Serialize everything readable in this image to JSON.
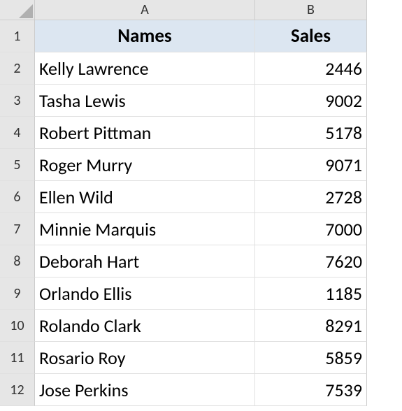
{
  "columns": {
    "A": "A",
    "B": "B"
  },
  "row_numbers": [
    "1",
    "2",
    "3",
    "4",
    "5",
    "6",
    "7",
    "8",
    "9",
    "10",
    "11",
    "12"
  ],
  "headers": {
    "names": "Names",
    "sales": "Sales"
  },
  "rows": [
    {
      "name": "Kelly Lawrence",
      "sales": "2446"
    },
    {
      "name": "Tasha Lewis",
      "sales": "9002"
    },
    {
      "name": "Robert Pittman",
      "sales": "5178"
    },
    {
      "name": "Roger Murry",
      "sales": "9071"
    },
    {
      "name": "Ellen Wild",
      "sales": "2728"
    },
    {
      "name": "Minnie Marquis",
      "sales": "7000"
    },
    {
      "name": "Deborah Hart",
      "sales": "7620"
    },
    {
      "name": "Orlando Ellis",
      "sales": "1185"
    },
    {
      "name": "Rolando Clark",
      "sales": "8291"
    },
    {
      "name": "Rosario Roy",
      "sales": "5859"
    },
    {
      "name": "Jose Perkins",
      "sales": "7539"
    }
  ]
}
